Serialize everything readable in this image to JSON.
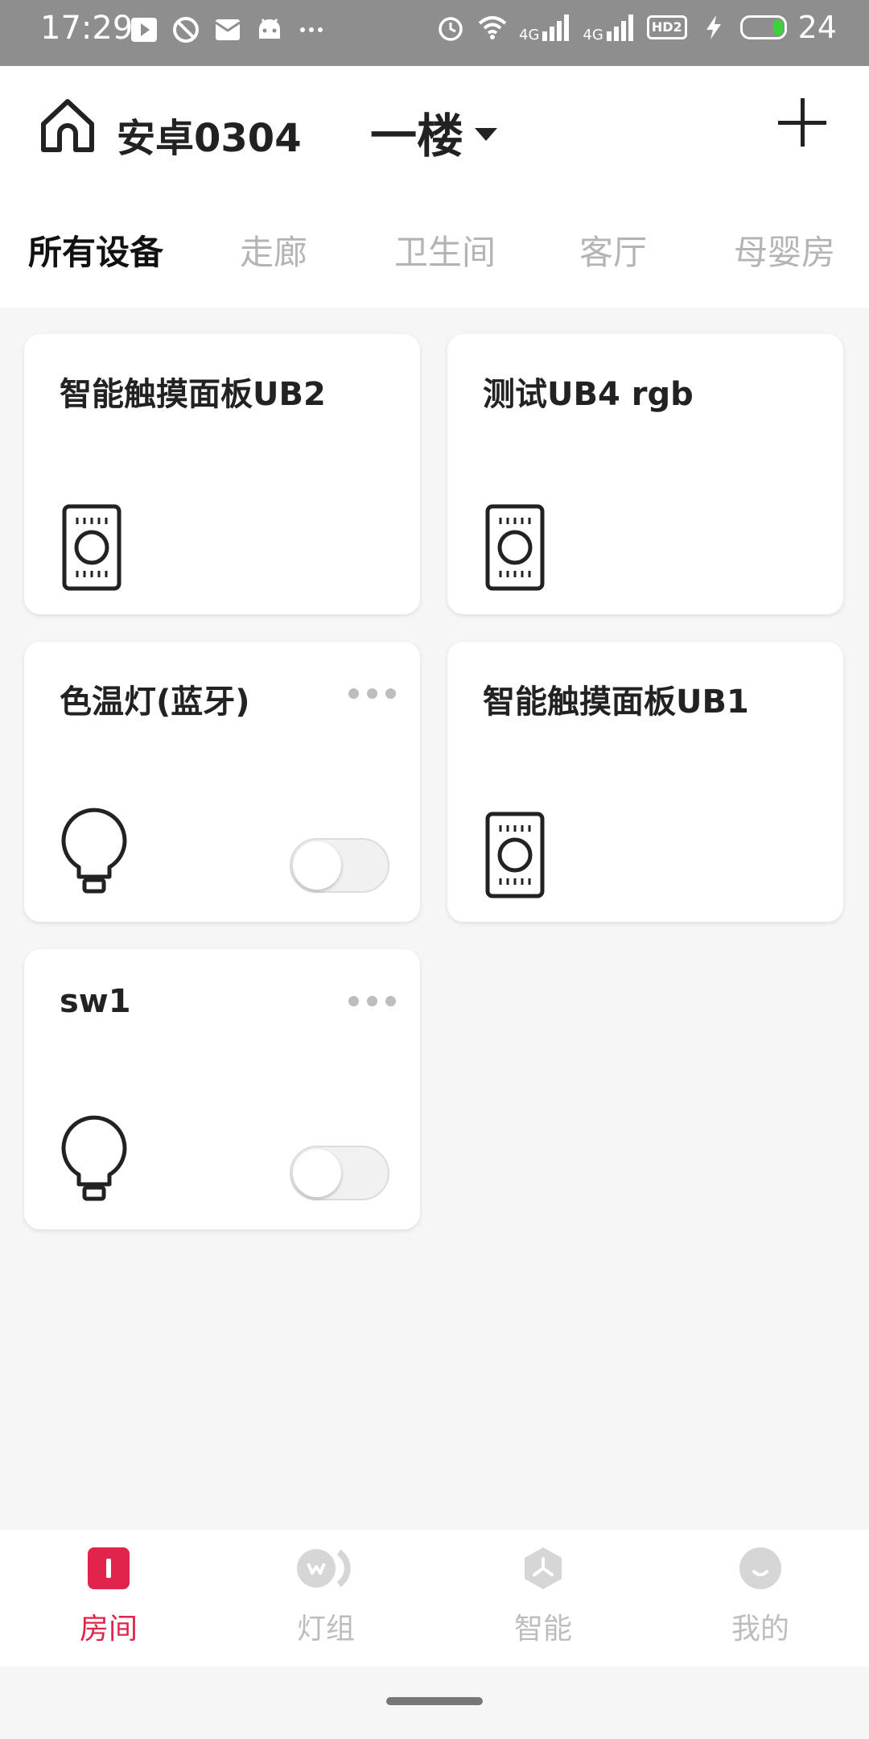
{
  "status_bar": {
    "time": "17:29",
    "battery_level": "24",
    "network_badge": "4G",
    "hd_badge": "HD2",
    "left_icons": [
      "play-icon",
      "do-not-disturb-icon",
      "mail-icon",
      "android-icon",
      "more-dots-icon"
    ],
    "right_icons": [
      "alarm-icon",
      "wifi-icon",
      "signal-icon",
      "signal-icon",
      "hd-icon",
      "charging-icon",
      "battery-icon"
    ]
  },
  "header": {
    "home_name": "安卓0304",
    "floor": "一楼"
  },
  "tabs": [
    {
      "label": "所有设备",
      "active": true
    },
    {
      "label": "走廊",
      "active": false
    },
    {
      "label": "卫生间",
      "active": false
    },
    {
      "label": "客厅",
      "active": false
    },
    {
      "label": "母婴房",
      "active": false
    }
  ],
  "devices": [
    {
      "name": "智能触摸面板UB2",
      "icon": "touch-panel-icon",
      "has_toggle": false
    },
    {
      "name": "测试UB4  rgb",
      "icon": "touch-panel-icon",
      "has_toggle": false
    },
    {
      "name": "色温灯(蓝牙)",
      "icon": "light-bulb-icon",
      "has_toggle": true,
      "on": false
    },
    {
      "name": "智能触摸面板UB1",
      "icon": "touch-panel-icon",
      "has_toggle": false
    },
    {
      "name": "sw1",
      "icon": "light-bulb-icon",
      "has_toggle": true,
      "on": false
    }
  ],
  "bottom_nav": [
    {
      "label": "房间",
      "icon": "room-icon",
      "active": true
    },
    {
      "label": "灯组",
      "icon": "light-group-icon",
      "active": false
    },
    {
      "label": "智能",
      "icon": "smart-icon",
      "active": false
    },
    {
      "label": "我的",
      "icon": "profile-icon",
      "active": false
    }
  ],
  "colors": {
    "accent": "#e0244a",
    "inactive": "#bdbdbd",
    "background": "#f6f6f6"
  }
}
